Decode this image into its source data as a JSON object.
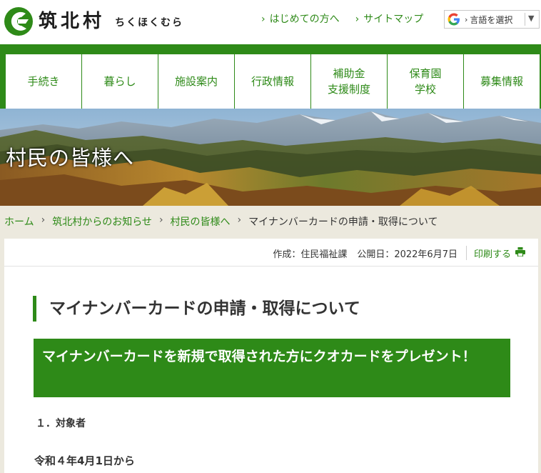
{
  "header": {
    "site_name": "筑北村",
    "site_kana": "ちくほくむら",
    "links": [
      "はじめての方へ",
      "サイトマップ"
    ],
    "translate_label": "言語を選択"
  },
  "nav": {
    "items": [
      "手続き",
      "暮らし",
      "施設案内",
      "行政情報",
      "補助金\n支援制度",
      "保育園\n学校",
      "募集情報"
    ]
  },
  "hero": {
    "title": "村民の皆様へ"
  },
  "breadcrumb": {
    "items": [
      "ホーム",
      "筑北村からのお知らせ",
      "村民の皆様へ"
    ],
    "current": "マイナンバーカードの申請・取得について"
  },
  "meta": {
    "author": "作成：住民福祉課",
    "published": "公開日：2022年6月7日",
    "print_label": "印刷する"
  },
  "article": {
    "title": "マイナンバーカードの申請・取得について",
    "banner": "マイナンバーカードを新規で取得された方にクオカードをプレゼント！",
    "section_heading": "１．対象者",
    "section_text": "令和４年4月1日から"
  },
  "colors": {
    "brand_green": "#2e8a18",
    "background": "#ece9de"
  }
}
